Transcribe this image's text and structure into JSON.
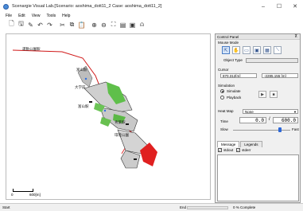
{
  "window": {
    "title": "Scenargie Visual Lab.[Scenario: aoshima_dott11_2 Case: aoshima_dott11_2]",
    "minimize": "–",
    "maximize": "☐",
    "close": "✕"
  },
  "menu": [
    "File",
    "Edit",
    "View",
    "Tools",
    "Help"
  ],
  "map": {
    "stations": [
      "運動公園駅",
      "富山駅",
      "大学前",
      "富山駅",
      "青葉駅",
      "環境公園"
    ],
    "scale_left": "0",
    "scale_right": "600[m]"
  },
  "status": {
    "start": "Start",
    "end": "End",
    "progress_percent": 0,
    "complete": "0 % Complete"
  },
  "control_panel": {
    "title": "Control Panel",
    "mouse_mode_label": "Mouse Mode",
    "object_type_label": "Object Type",
    "object_type_value": "",
    "cursor_label": "Cursor",
    "cursor_x": "870.312[m]",
    "cursor_y": "-2285.155 [m]",
    "simulation_label": "Simulation",
    "simulate_label": "Simulate",
    "playback_label": "Playback",
    "heatmap_label": "Heat Map",
    "heatmap_value": "None",
    "time_label": "Time",
    "time_current": "0.0",
    "time_sep": "/",
    "time_total": "600.0",
    "slow_label": "Slow",
    "fast_label": "Fast",
    "speed_fraction": 0.82,
    "tabs": [
      "Message",
      "Legends"
    ],
    "stdout_label": "stdout",
    "stderr_label": "stderr"
  }
}
